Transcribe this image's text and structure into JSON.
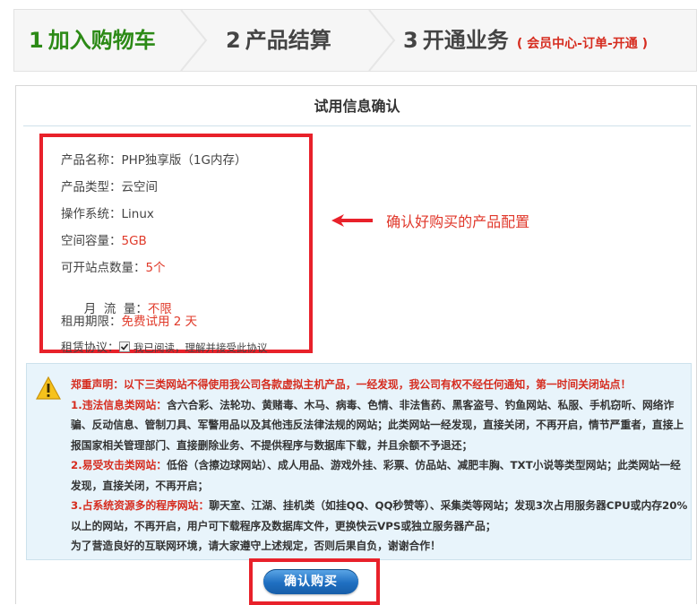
{
  "steps": [
    {
      "num": "1",
      "title": "加入购物车"
    },
    {
      "num": "2",
      "title": "产品结算"
    },
    {
      "num": "3",
      "title": "开通业务",
      "note": "( 会员中心-订单-开通 )"
    }
  ],
  "panel": {
    "title": "试用信息确认"
  },
  "product_info": {
    "name_label": "产品名称：",
    "name_value": "PHP独享版（1G内存）",
    "type_label": "产品类型：",
    "type_value": "云空间",
    "os_label": "操作系统：",
    "os_value": "Linux",
    "space_label": "空间容量：",
    "space_value": "5GB",
    "sites_label": "可开站点数量：",
    "sites_value": "5个",
    "traffic_label": "月  流  量：",
    "traffic_value": "不限",
    "period_label": "租用期限：",
    "period_value": "免费试用 2 天",
    "agreement_label": "租赁协议：",
    "agreement_text": "我已阅读，理解并接受此协议",
    "agreement_checked": true
  },
  "callout": {
    "text": "确认好购买的产品配置"
  },
  "notice": {
    "heading": "郑重声明：以下三类网站不得使用我公司各款虚拟主机产品，一经发现，我公司有权不经任何通知，第一时间关闭站点！",
    "item1_title": "1.违法信息类网站：",
    "item1_text": "含六合彩、法轮功、黄赌毒、木马、病毒、色情、非法售药、黑客盗号、钓鱼网站、私服、手机窃听、网络诈骗、反动信息、管制刀具、军警用品以及其他违反法律法规的网站；此类网站一经发现，直接关闭，不再开启，情节严重者，直接上报国家相关管理部门、直接删除业务、不提供程序与数据库下载，并且余额不予退还；",
    "item2_title": "2.易受攻击类网站：",
    "item2_text": "低俗（含擦边球网站）、成人用品、游戏外挂、彩票、仿品站、减肥丰胸、TXT小说等类型网站；此类网站一经发现，直接关闭，不再开启；",
    "item3_title": "3.占系统资源多的程序网站：",
    "item3_text": "聊天室、江湖、挂机类（如挂QQ、QQ秒赞等）、采集类等网站；发现3次占用服务器CPU或内存20%以上的网站，不再开启，用户可下载程序及数据库文件，更换快云VPS或独立服务器产品；",
    "closing": "为了营造良好的互联网环境，请大家遵守上述规定，否则后果自负，谢谢合作！"
  },
  "confirm_button": {
    "label": "确认购买"
  },
  "colors": {
    "step_active": "#2c8a16",
    "highlight_red": "#e8212a",
    "notice_bg": "#e8f4fb",
    "button_blue": "#1f6fc1"
  },
  "icons": {
    "warning": "warning-icon",
    "arrow": "arrow-left-icon",
    "check": "checkmark-icon"
  }
}
